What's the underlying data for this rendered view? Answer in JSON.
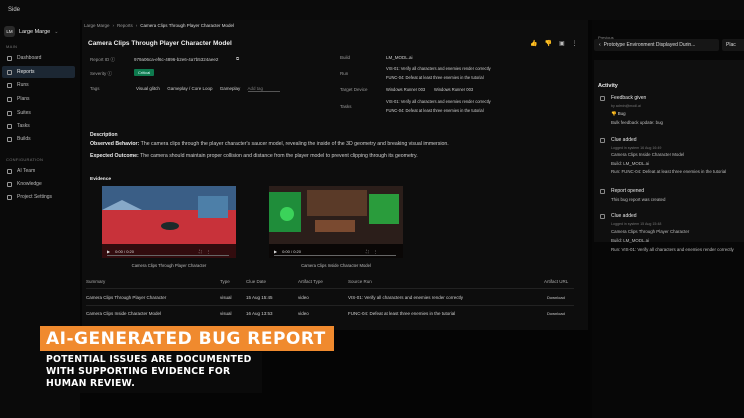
{
  "window": {
    "title": "Side"
  },
  "workspace": {
    "initials": "LM",
    "name": "Large Marge",
    "chevron": "chevron-down-icon"
  },
  "sidebar": {
    "main_label": "MAIN",
    "main_items": [
      {
        "label": "Dashboard",
        "icon": "grid-icon"
      },
      {
        "label": "Reports",
        "icon": "report-icon",
        "active": true
      },
      {
        "label": "Runs",
        "icon": "play-icon"
      },
      {
        "label": "Plans",
        "icon": "plan-icon"
      },
      {
        "label": "Suites",
        "icon": "suite-icon"
      },
      {
        "label": "Tasks",
        "icon": "task-icon"
      },
      {
        "label": "Builds",
        "icon": "build-icon"
      }
    ],
    "config_label": "CONFIGURATION",
    "config_items": [
      {
        "label": "AI Team",
        "icon": "ai-icon"
      },
      {
        "label": "Knowledge",
        "icon": "book-icon"
      },
      {
        "label": "Project Settings",
        "icon": "gear-icon"
      }
    ]
  },
  "breadcrumb": [
    "Large Marge",
    "Reports",
    "Camera Clips Through Player Character Model"
  ],
  "report": {
    "title": "Camera Clips Through Player Character Model",
    "id_label": "Report ID",
    "id_value": "979a06ca-ef6c-4896-b2e6-4a7b5324aee2",
    "severity_label": "Severity",
    "severity_value": "Critical",
    "tags_label": "Tags",
    "tags": [
      "Visual glitch",
      "Gameplay / Core Loop",
      "Gameplay"
    ],
    "add_tag_placeholder": "Add tag",
    "build_label": "Build",
    "build_value": "LM_MODL.ai",
    "run_label": "Run",
    "runs": [
      "VIS-01: Verify all characters and enemies render correctly",
      "FUNC-04: Defeat at least three enemies in the tutorial"
    ],
    "target_label": "Target Device",
    "targets": [
      "Windows Runner 003",
      "Windows Runner 003"
    ],
    "tasks_label": "Tasks",
    "tasks": [
      "VIS-01: Verify all characters and enemies render correctly",
      "FUNC-04: Defeat at least three enemies in the tutorial"
    ]
  },
  "description": {
    "heading": "Description",
    "observed_label": "Observed Behavior:",
    "observed_text": "The camera clips through the player character's saucer model, revealing the inside of the 3D geometry and breaking visual immersion.",
    "expected_label": "Expected Outcome:",
    "expected_text": "The camera should maintain proper collision and distance from the player model to prevent clipping through its geometry."
  },
  "evidence": {
    "heading": "Evidence",
    "videos": [
      {
        "time": "0:00 / 0:20",
        "caption": "Camera Clips Through Player Character"
      },
      {
        "time": "0:00 / 0:20",
        "caption": "Camera Clips Inside Character Model"
      }
    ]
  },
  "table": {
    "headers": [
      "Summary",
      "Type",
      "Clue Date",
      "Artifact Type",
      "Source Run",
      "Artifact URL"
    ],
    "rows": [
      {
        "summary": "Camera Clips Through Player Character",
        "type": "visual",
        "date": "15 Aug 15:45",
        "artifact": "video",
        "run": "VIS-01: Verify all characters and enemies render correctly",
        "url": "Download"
      },
      {
        "summary": "Camera Clips Inside Character Model",
        "type": "visual",
        "date": "16 Aug 13:53",
        "artifact": "video",
        "run": "FUNC-04: Defeat at least three enemies in the tutorial",
        "url": "Download"
      }
    ]
  },
  "right": {
    "previous_label": "Previous",
    "previous_item": "Prototype Environment Displayed Durin...",
    "placeholder_label": "Plac",
    "activity_heading": "Activity",
    "events": [
      {
        "title": "Feedback given",
        "sub": "by admin@modl.ai",
        "lines": [
          "Bulk feedback update: bug"
        ],
        "bug": "Bug",
        "icon": "feedback-icon"
      },
      {
        "title": "Clue added",
        "sub": "Logged in system 16 Aug 16:49",
        "lines": [
          "Camera Clips Inside Character Model",
          "Build: LM_MODL.ai",
          "Run: FUNC-04: Defeat at least three enemies in the tutorial"
        ],
        "icon": "clue-icon"
      },
      {
        "title": "Report opened",
        "sub": "",
        "lines": [
          "This bug report was created"
        ],
        "icon": "report-icon"
      },
      {
        "title": "Clue added",
        "sub": "Logged in system 15 Aug 15:48",
        "lines": [
          "Camera Clips Through Player Character",
          "Build: LM_MODL.ai",
          "Run: VIS-01: Verify all characters and enemies render correctly"
        ],
        "icon": "clue-icon"
      }
    ]
  },
  "overlay": {
    "headline": "AI-GENERATED BUG REPORT",
    "subline": "POTENTIAL ISSUES ARE DOCUMENTED WITH SUPPORTING EVIDENCE FOR HUMAN REVIEW."
  },
  "colors": {
    "accent": "#f08a2e",
    "critical": "#0e7a4e",
    "active_nav": "#1c2733"
  }
}
